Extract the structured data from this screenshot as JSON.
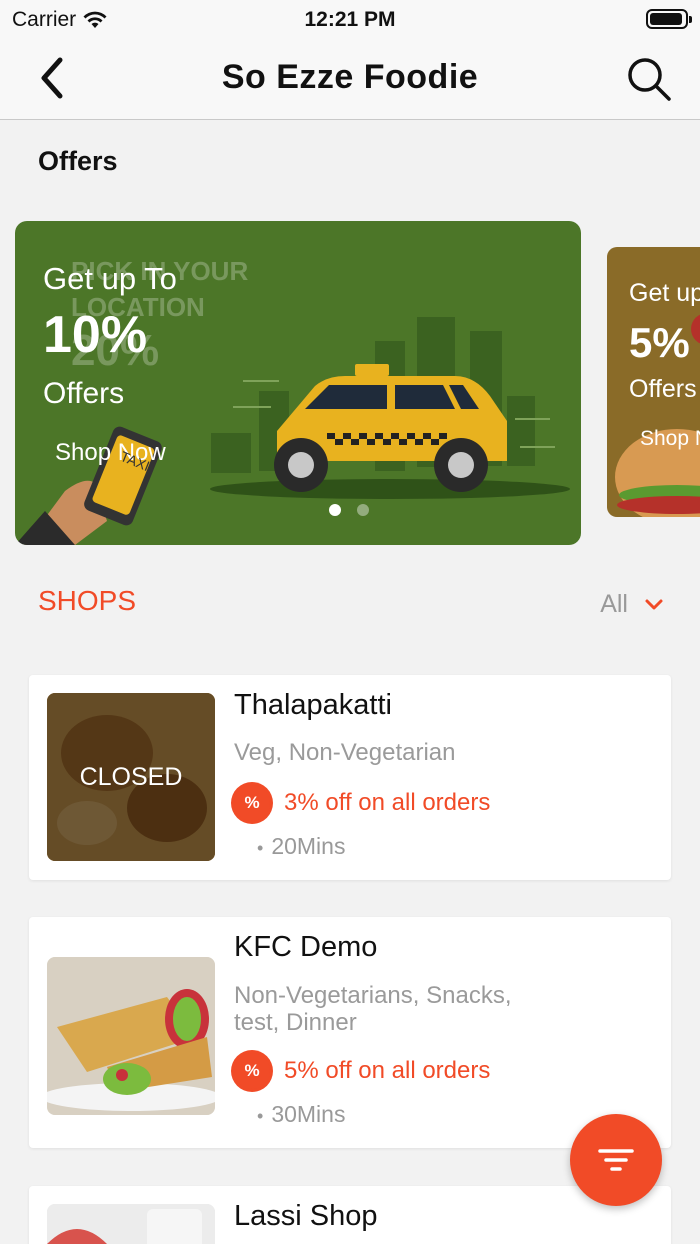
{
  "status_bar": {
    "carrier": "Carrier",
    "time": "12:21 PM"
  },
  "nav": {
    "title": "So Ezze Foodie"
  },
  "offers": {
    "heading": "Offers",
    "banners": [
      {
        "line1": "Get up To",
        "percent": "10%",
        "line3": "Offers",
        "cta": "Shop Now",
        "watermark1": "PICK IN YOUR",
        "watermark2": "LOCATION",
        "watermark3": "20%",
        "phone_text": "TAXI"
      },
      {
        "line1": "Get up To",
        "percent": "5%",
        "line3": "Offers",
        "cta": "Shop Now"
      }
    ],
    "pager": {
      "count": 2,
      "active": 0
    }
  },
  "shops": {
    "heading": "SHOPS",
    "filter_label": "All",
    "items": [
      {
        "name": "Thalapakatti",
        "cuisines": "Veg, Non-Vegetarian",
        "offer": "3% off on all orders",
        "time": "20Mins",
        "status": "CLOSED",
        "badge": "%"
      },
      {
        "name": "KFC Demo",
        "cuisines": "Non-Vegetarians, Snacks, test, Dinner",
        "offer": "5% off on all orders",
        "time": "30Mins",
        "badge": "%"
      },
      {
        "name": "Lassi Shop"
      }
    ]
  },
  "colors": {
    "accent": "#f14b27",
    "banner_green": "#4c7628",
    "taxi_yellow": "#e8b21f"
  },
  "icons": [
    "back-chevron-icon",
    "search-icon",
    "wifi-icon",
    "battery-icon",
    "chevron-down-icon",
    "discount-badge-icon",
    "filter-icon"
  ]
}
